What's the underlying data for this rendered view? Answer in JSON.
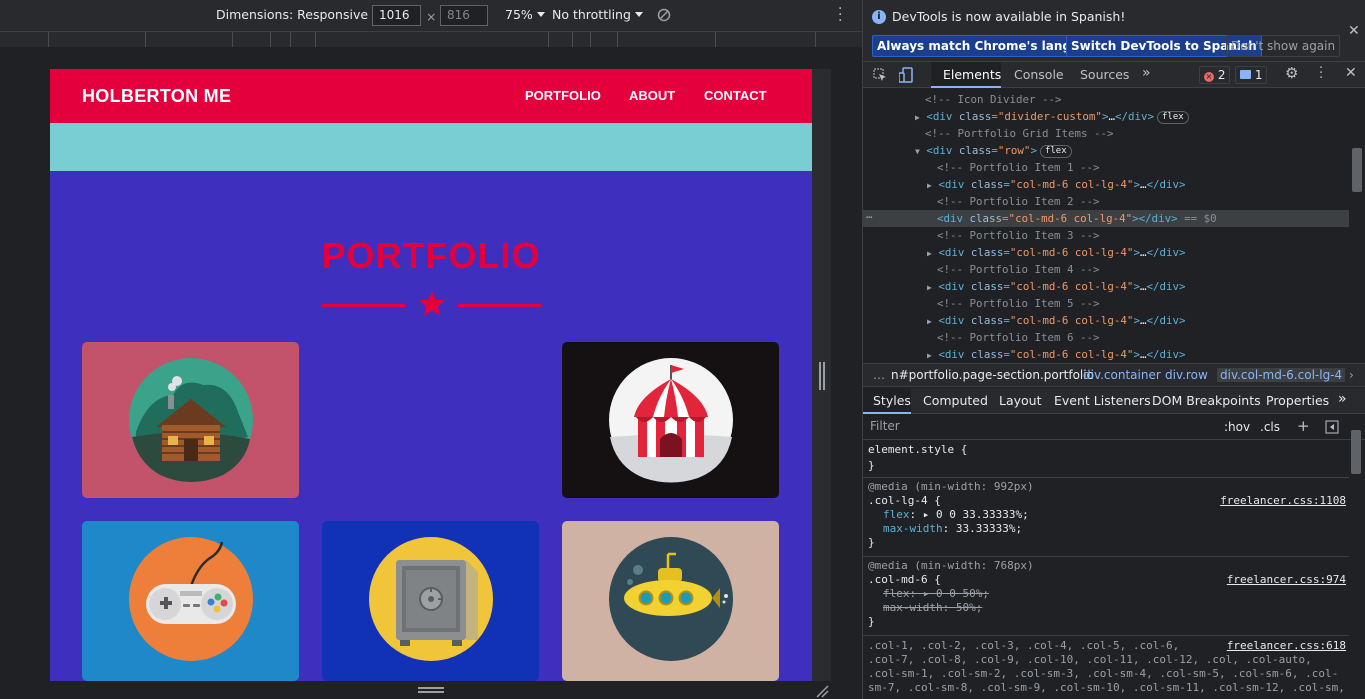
{
  "device_toolbar": {
    "dimensions_label": "Dimensions: Responsive",
    "width_value": "1016",
    "height_value": "816",
    "times": "×",
    "zoom": "75%",
    "throttling": "No throttling"
  },
  "site": {
    "brand": "HOLBERTON ME",
    "nav": [
      "PORTFOLIO",
      "ABOUT",
      "CONTACT"
    ],
    "section_title": "PORTFOLIO",
    "colors": {
      "navbar": "#e4003c",
      "band": "#79ced3",
      "section_bg": "#3f2fbf"
    },
    "cards": [
      {
        "icon": "cabin-icon",
        "bg": "#c2536a"
      },
      {
        "icon": "circus-tent-icon",
        "bg": "#151012"
      },
      {
        "icon": "game-controller-icon",
        "bg": "#1e88c8"
      },
      {
        "icon": "safe-icon",
        "bg": "#1132b7"
      },
      {
        "icon": "submarine-icon",
        "bg": "#cfb2a3"
      }
    ]
  },
  "devtools": {
    "info_text": "DevTools is now available in Spanish!",
    "info_buttons": [
      "Always match Chrome's language",
      "Switch DevTools to Spanish",
      "Don't show again"
    ],
    "tabs": [
      "Elements",
      "Console",
      "Sources"
    ],
    "error_count": "2",
    "message_count": "1",
    "dom": {
      "c_icon_divider": "<!-- Icon Divider -->",
      "divider_custom": "divider-custom",
      "c_portfolio_grid": "<!-- Portfolio Grid Items -->",
      "row_class": "row",
      "flex": "flex",
      "item_class": "col-md-6 col-lg-4",
      "comments": [
        "<!-- Portfolio Item 1 -->",
        "<!-- Portfolio Item 2 -->",
        "<!-- Portfolio Item 3 -->",
        "<!-- Portfolio Item 4 -->",
        "<!-- Portfolio Item 5 -->",
        "<!-- Portfolio Item 6 -->"
      ],
      "selected_suffix": "== $0"
    },
    "breadcrumbs": [
      "n#portfolio.page-section.portfolio",
      "div.container",
      "div.row",
      "div.col-md-6.col-lg-4"
    ],
    "subtabs": [
      "Styles",
      "Computed",
      "Layout",
      "Event Listeners",
      "DOM Breakpoints",
      "Properties"
    ],
    "filter_placeholder": "Filter",
    "hov": ":hov",
    "cls": ".cls",
    "styles": {
      "element_style": "element.style {",
      "close": "}",
      "rule1_media": "@media (min-width: 992px)",
      "rule1_selector": ".col-lg-4 {",
      "rule1_src": "freelancer.css:1108",
      "rule1_props": [
        [
          "flex",
          "0 0 33.33333%;"
        ],
        [
          "max-width",
          "33.33333%;"
        ]
      ],
      "rule2_media": "@media (min-width: 768px)",
      "rule2_selector": ".col-md-6 {",
      "rule2_src": "freelancer.css:974",
      "rule2_props": [
        [
          "flex",
          "0 0 50%;"
        ],
        [
          "max-width",
          "50%;"
        ]
      ],
      "rule3_src": "freelancer.css:618",
      "rule3_lines": [
        ".col-1, .col-2, .col-3, .col-4, .col-5, .col-6,",
        ".col-7, .col-8, .col-9, .col-10, .col-11, .col-12, .col, .col-auto,",
        ".col-sm-1, .col-sm-2, .col-sm-3, .col-sm-4, .col-sm-5, .col-sm-6, .col-",
        "sm-7, .col-sm-8, .col-sm-9, .col-sm-10, .col-sm-11, .col-sm-12, .col-sm,"
      ]
    }
  }
}
